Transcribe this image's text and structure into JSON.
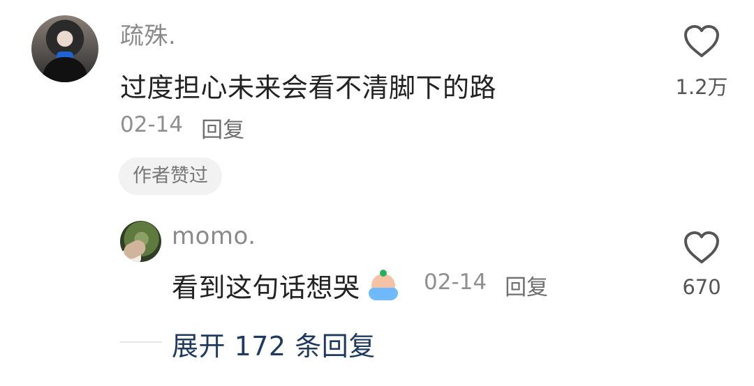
{
  "main_comment": {
    "username": "疏殊.",
    "text": "过度担心未来会看不清脚下的路",
    "date": "02-14",
    "reply_label": "回复",
    "author_liked_badge": "作者赞过",
    "like_count": "1.2万"
  },
  "reply_comment": {
    "username": "momo.",
    "text": "看到这句话想哭",
    "emoji_name": "crying-emoji",
    "date": "02-14",
    "reply_label": "回复",
    "like_count": "670"
  },
  "expand": {
    "label": "展开 172 条回复"
  },
  "colors": {
    "primary_text": "#222222",
    "secondary_text": "#8f8f8f",
    "expand_link": "#1e3a5f",
    "badge_bg": "#f2f2f2"
  }
}
